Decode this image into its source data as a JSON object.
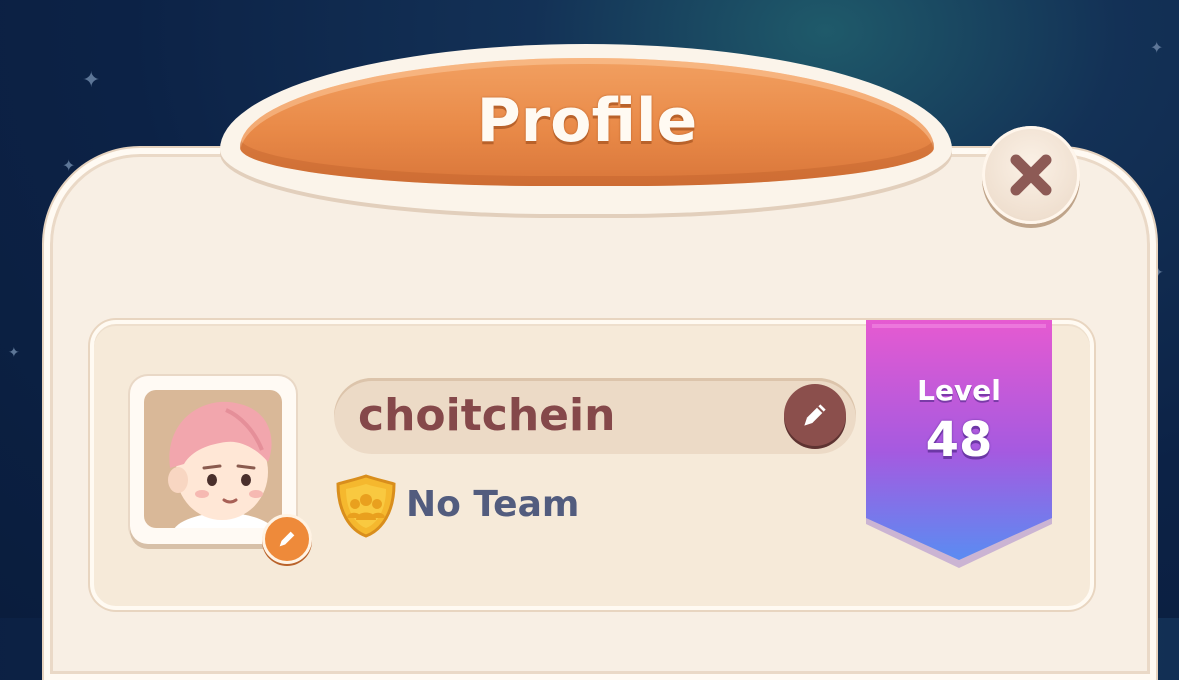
{
  "dialog": {
    "title": "Profile",
    "close_icon": "close-x-icon"
  },
  "profile": {
    "username": "choitchein",
    "team": "No Team",
    "level_label": "Level",
    "level_value": "48"
  },
  "icons": {
    "avatar": "user-avatar",
    "avatar_edit": "pencil-icon",
    "name_edit": "pencil-icon",
    "team": "team-shield-icon"
  },
  "colors": {
    "title_wood": "#e98a48",
    "name_text": "#85484a",
    "team_text": "#525c7e",
    "ribbon_top": "#e65ad1",
    "ribbon_bottom": "#5a8cf2"
  }
}
